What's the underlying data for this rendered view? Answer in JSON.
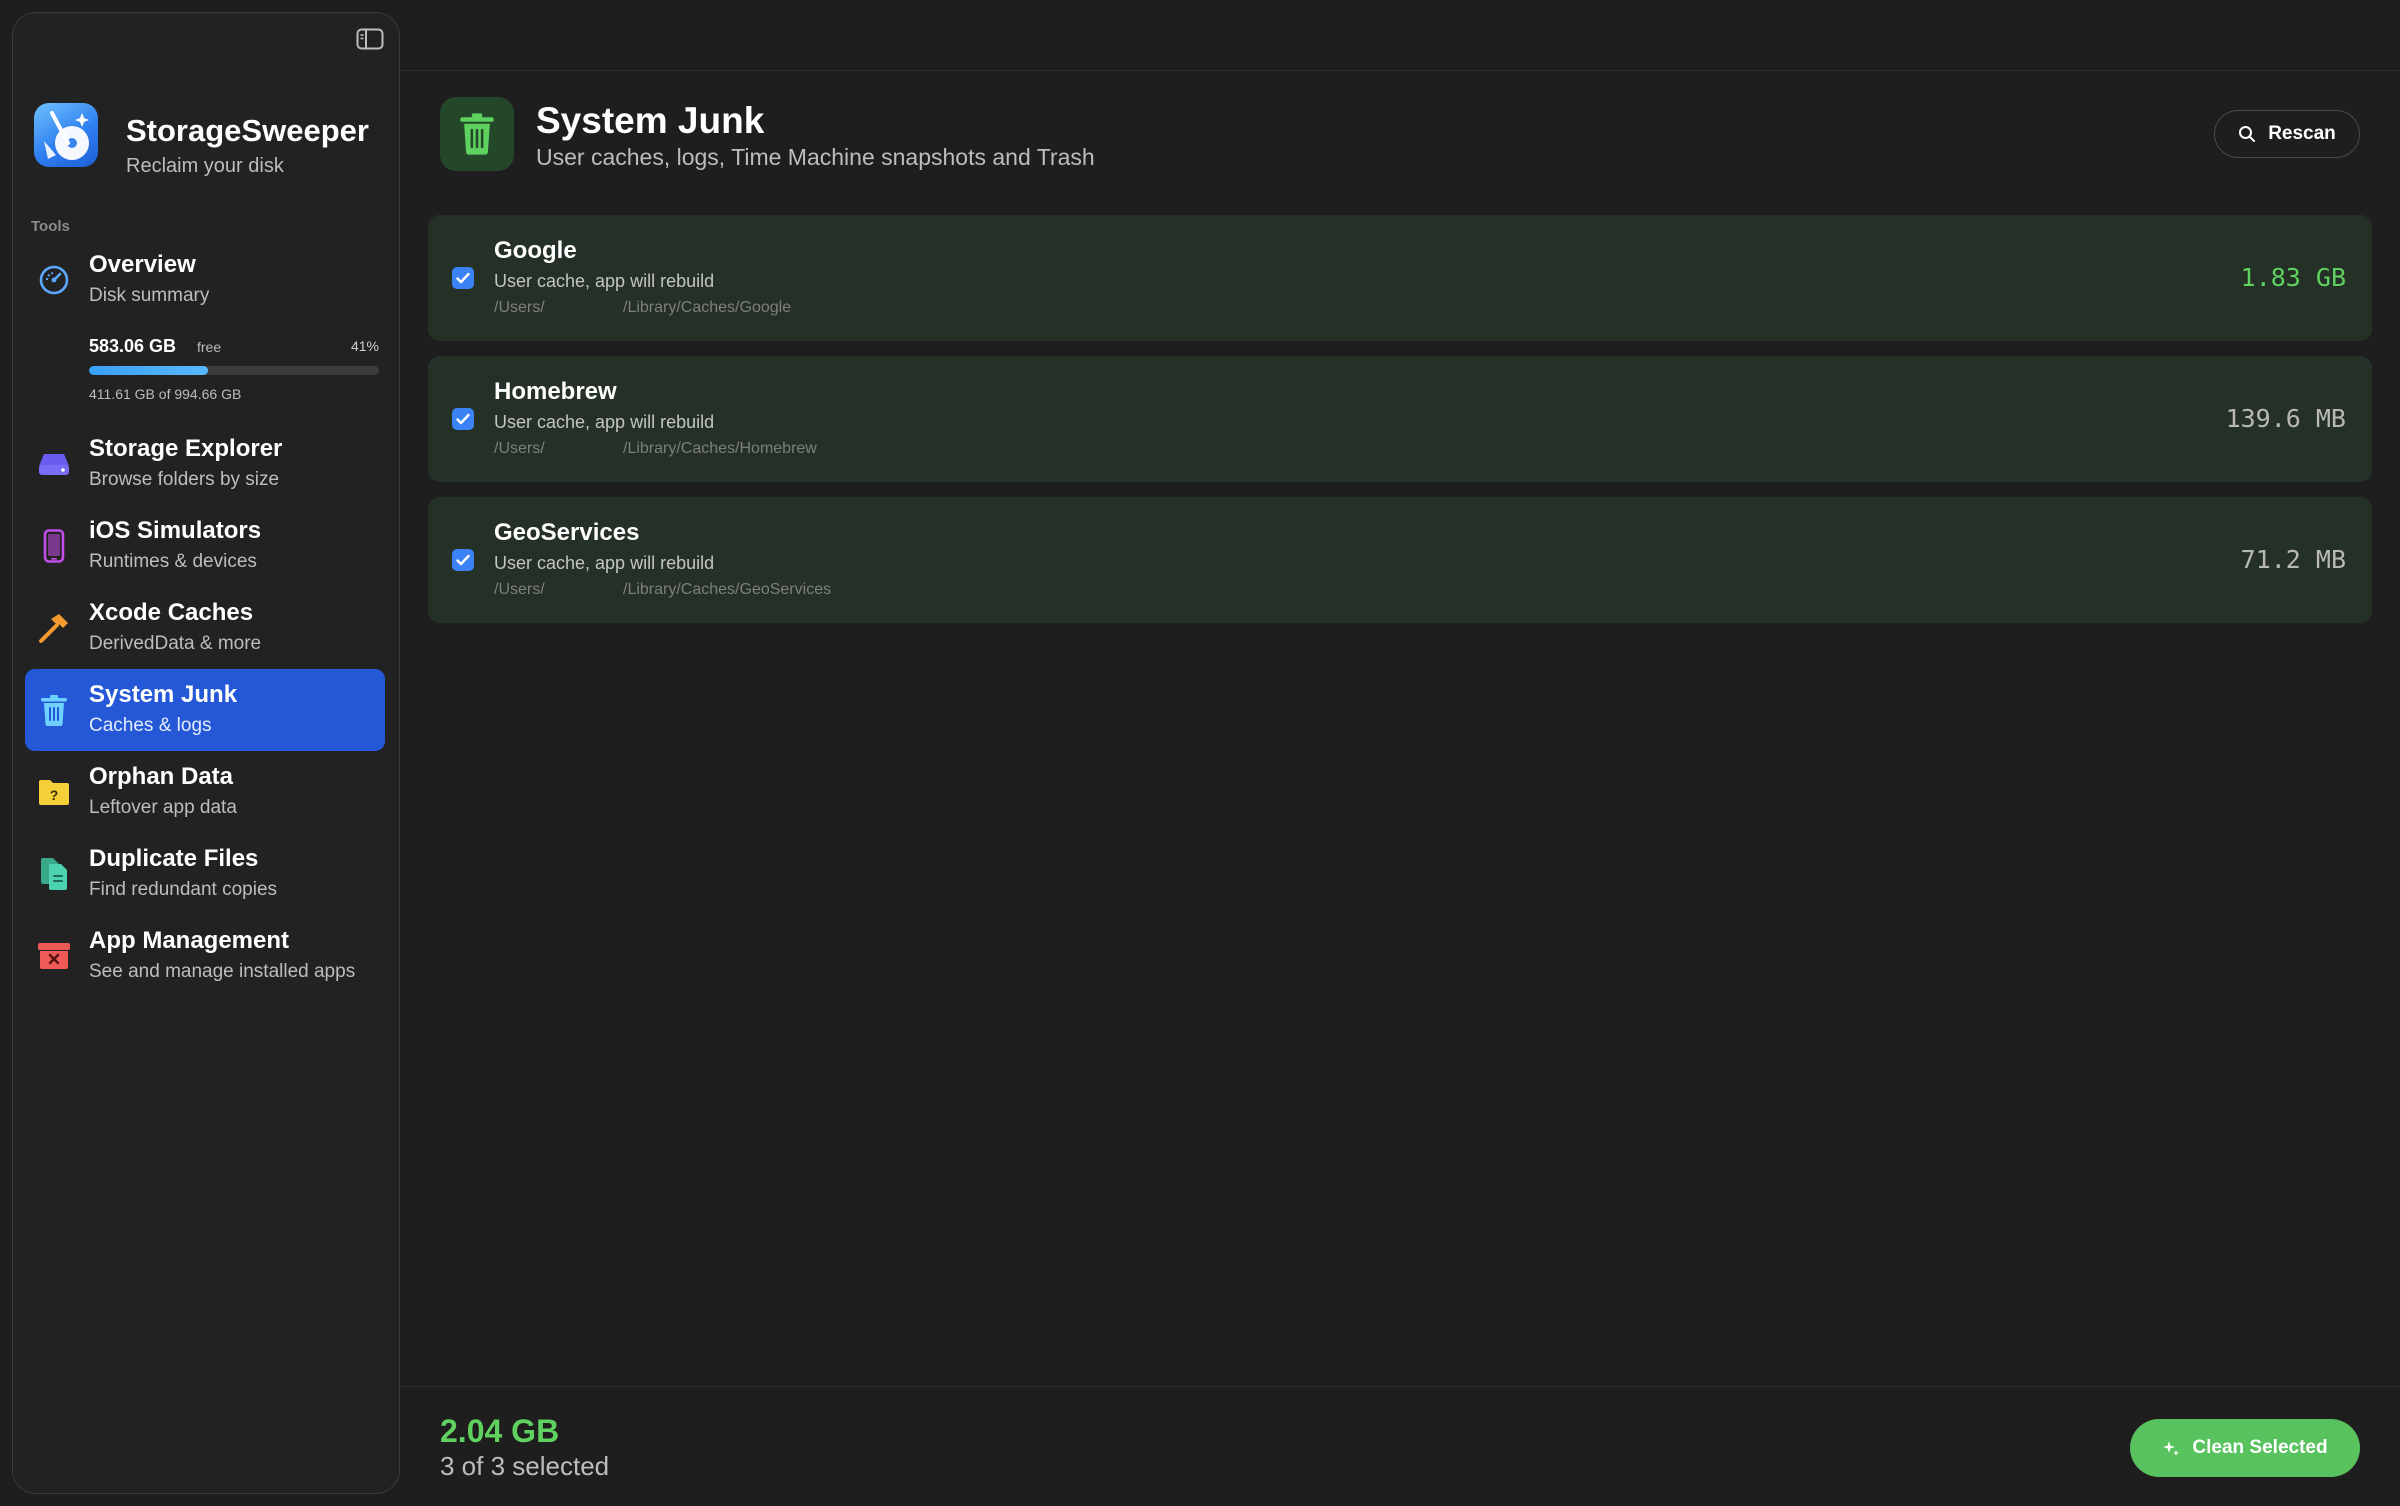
{
  "app": {
    "name": "StorageSweeper",
    "tagline": "Reclaim your disk"
  },
  "sidebar": {
    "section_label": "Tools",
    "disk": {
      "free": "583.06 GB",
      "free_label": "free",
      "percent": "41%",
      "usage": "411.61 GB of 994.66 GB",
      "used_fraction": 0.41
    },
    "items": [
      {
        "title": "Overview",
        "subtitle": "Disk summary",
        "icon": "gauge-icon",
        "color": "#5aa9ff"
      },
      {
        "title": "Storage Explorer",
        "subtitle": "Browse folders by size",
        "icon": "drive-icon",
        "color": "#7b6cf6"
      },
      {
        "title": "iOS Simulators",
        "subtitle": "Runtimes & devices",
        "icon": "iphone-icon",
        "color": "#c14ee8"
      },
      {
        "title": "Xcode Caches",
        "subtitle": "DerivedData & more",
        "icon": "hammer-icon",
        "color": "#f29a2e"
      },
      {
        "title": "System Junk",
        "subtitle": "Caches & logs",
        "icon": "trash-icon",
        "color": "#6fd1ff",
        "active": true
      },
      {
        "title": "Orphan Data",
        "subtitle": "Leftover app data",
        "icon": "question-folder-icon",
        "color": "#f4cf3a"
      },
      {
        "title": "Duplicate Files",
        "subtitle": "Find redundant copies",
        "icon": "duplicate-docs-icon",
        "color": "#4ed3b0"
      },
      {
        "title": "App Management",
        "subtitle": "See and manage installed apps",
        "icon": "archive-x-icon",
        "color": "#ee5b57"
      }
    ]
  },
  "header": {
    "title": "System Junk",
    "subtitle": "User caches, logs, Time Machine snapshots and Trash",
    "rescan_label": "Rescan",
    "icon_color": "#5fd15f"
  },
  "items": [
    {
      "name": "Google",
      "description": "User cache, app will rebuild",
      "path_prefix": "/Users/",
      "path_suffix": "/Library/Caches/Google",
      "size": "1.83 GB",
      "checked": true
    },
    {
      "name": "Homebrew",
      "description": "User cache, app will rebuild",
      "path_prefix": "/Users/",
      "path_suffix": "/Library/Caches/Homebrew",
      "size": "139.6 MB",
      "checked": true
    },
    {
      "name": "GeoServices",
      "description": "User cache, app will rebuild",
      "path_prefix": "/Users/",
      "path_suffix": "/Library/Caches/GeoServices",
      "size": "71.2 MB",
      "checked": true
    }
  ],
  "footer": {
    "total_size": "2.04 GB",
    "selection_summary": "3 of 3 selected",
    "clean_label": "Clean Selected"
  },
  "colors": {
    "accent_blue": "#2558d6",
    "success_green": "#5fd15f",
    "row_background": "#253127"
  }
}
